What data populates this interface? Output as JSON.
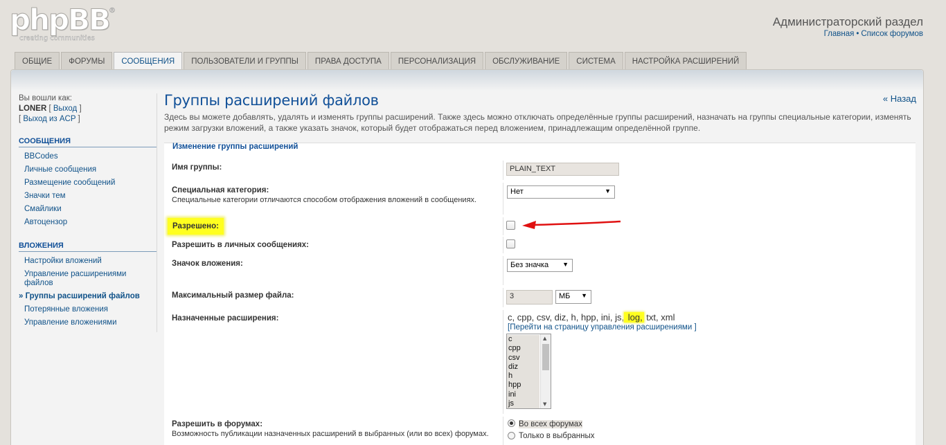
{
  "brand": {
    "name": "phpBB",
    "registered": "®",
    "tagline": "creating communities"
  },
  "header": {
    "title": "Администраторский раздел",
    "links": [
      "Главная",
      "Список форумов"
    ],
    "link_separator": "•"
  },
  "tabs": [
    {
      "label": "ОБЩИЕ",
      "active": false
    },
    {
      "label": "ФОРУМЫ",
      "active": false
    },
    {
      "label": "СООБЩЕНИЯ",
      "active": true
    },
    {
      "label": "ПОЛЬЗОВАТЕЛИ И ГРУППЫ",
      "active": false
    },
    {
      "label": "ПРАВА ДОСТУПА",
      "active": false
    },
    {
      "label": "ПЕРСОНАЛИЗАЦИЯ",
      "active": false
    },
    {
      "label": "ОБСЛУЖИВАНИЕ",
      "active": false
    },
    {
      "label": "СИСТЕМА",
      "active": false
    },
    {
      "label": "НАСТРОЙКА РАСШИРЕНИЙ",
      "active": false
    }
  ],
  "sidebar": {
    "logged_in_as": "Вы вошли как:",
    "username": "LONER",
    "logout": "Выход",
    "logout_acp": "Выход из ACP",
    "sections": [
      {
        "title": "СООБЩЕНИЯ",
        "items": [
          "BBCodes",
          "Личные сообщения",
          "Размещение сообщений",
          "Значки тем",
          "Смайлики",
          "Автоцензор"
        ]
      },
      {
        "title": "ВЛОЖЕНИЯ",
        "items": [
          "Настройки вложений",
          "Управление расширениями файлов",
          "Группы расширений файлов",
          "Потерянные вложения",
          "Управление вложениями"
        ],
        "active_index": 2
      }
    ]
  },
  "main": {
    "title": "Группы расширений файлов",
    "back": "« Назад",
    "intro": "Здесь вы можете добавлять, удалять и изменять группы расширений. Также здесь можно отключать определённые группы расширений, назначать на группы специальные категории, изменять режим загрузки вложений, а также указать значок, который будет отображаться перед вложением, принадлежащим определённой группе.",
    "legend": "Изменение группы расширений",
    "group_name": {
      "label": "Имя группы:",
      "value": "PLAIN_TEXT"
    },
    "special_category": {
      "label": "Специальная категория:",
      "explain": "Специальные категории отличаются способом отображения вложений в сообщениях.",
      "value": "Нет"
    },
    "allowed": {
      "label": "Разрешено:",
      "checked": false,
      "highlight_color": "#ffff1f",
      "arrow_color": "#e01010"
    },
    "allow_in_pm": {
      "label": "Разрешить в личных сообщениях:",
      "checked": false
    },
    "icon": {
      "label": "Значок вложения:",
      "value": "Без значка"
    },
    "max_filesize": {
      "label": "Максимальный размер файла:",
      "value": "3",
      "unit": "МБ"
    },
    "assigned_extensions": {
      "label": "Назначенные расширения:",
      "list_before": "c, cpp, csv, diz, h, hpp, ini, js,",
      "list_highlight": " log,",
      "list_after": " txt, xml",
      "manage_link": "[Перейти на страницу управления расширениями ]",
      "options": [
        "c",
        "cpp",
        "csv",
        "diz",
        "h",
        "hpp",
        "ini",
        "js"
      ]
    },
    "allow_in_forums": {
      "label": "Разрешить в форумах:",
      "explain": "Возможность публикации назначенных расширений в выбранных (или во всех) форумах.",
      "options": [
        "Во всех форумах",
        "Только в выбранных"
      ],
      "selected": 0
    }
  }
}
